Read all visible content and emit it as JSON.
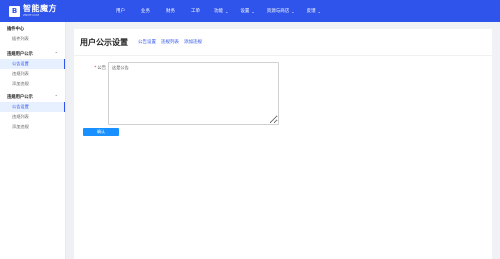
{
  "brand": {
    "name": "智能魔方",
    "sub": "ZNMF.COM",
    "mark": "B"
  },
  "nav": {
    "items": [
      {
        "label": "用户",
        "dropdown": false
      },
      {
        "label": "业务",
        "dropdown": false
      },
      {
        "label": "财务",
        "dropdown": false
      },
      {
        "label": "工单",
        "dropdown": false
      },
      {
        "label": "功能",
        "dropdown": true
      },
      {
        "label": "设置",
        "dropdown": true
      },
      {
        "label": "资源与商店",
        "dropdown": true
      },
      {
        "label": "反馈",
        "dropdown": true
      }
    ]
  },
  "sidebar": {
    "groups": [
      {
        "label": "插件中心",
        "items": [
          {
            "label": "插件列表",
            "active": false
          }
        ]
      },
      {
        "label": "违规用户公示",
        "items": [
          {
            "label": "公告设置",
            "active": true
          },
          {
            "label": "违规列表",
            "active": false
          },
          {
            "label": "添加违规",
            "active": false
          }
        ]
      },
      {
        "label": "违规用户公示",
        "items": [
          {
            "label": "公告设置",
            "active": true
          },
          {
            "label": "违规列表",
            "active": false
          },
          {
            "label": "添加违规",
            "active": false
          }
        ]
      }
    ]
  },
  "main": {
    "title": "用户公示设置",
    "tabs": [
      "公告设置",
      "违规列表",
      "添加违规"
    ],
    "form": {
      "label": "公告",
      "required_mark": "*",
      "value": "这是公告"
    },
    "submit_label": "确认"
  }
}
